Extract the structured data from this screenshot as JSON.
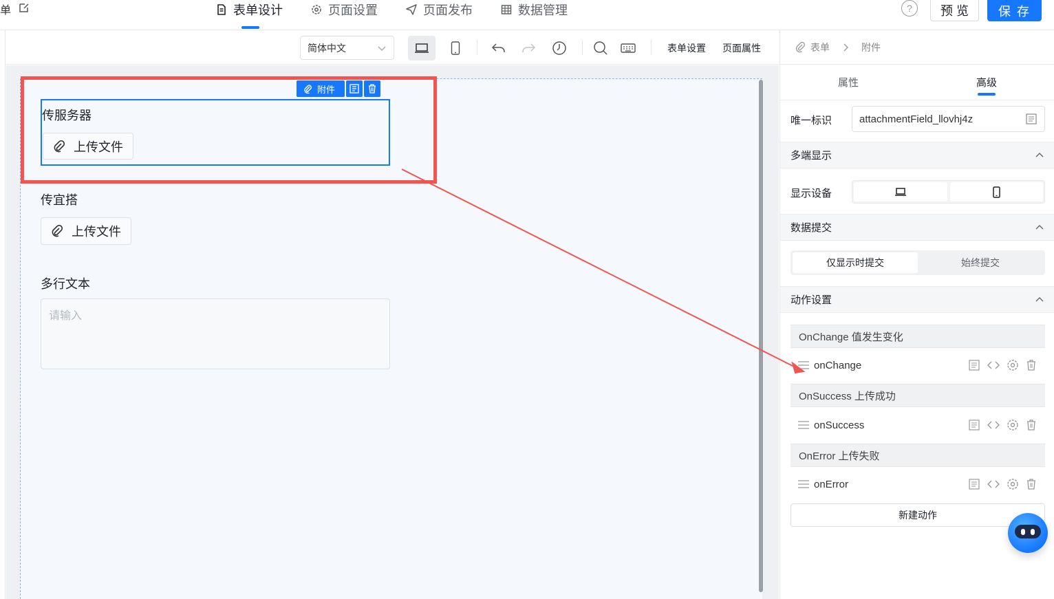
{
  "header": {
    "left_partial_text": "单",
    "tabs": [
      {
        "label": "表单设计",
        "icon": "doc-icon",
        "active": true
      },
      {
        "label": "页面设置",
        "icon": "gear-icon",
        "active": false
      },
      {
        "label": "页面发布",
        "icon": "send-icon",
        "active": false
      },
      {
        "label": "数据管理",
        "icon": "grid-icon",
        "active": false
      }
    ],
    "help_glyph": "?",
    "preview_label": "预 览",
    "save_label": "保 存",
    "accent_color": "#1677ff"
  },
  "toolbar": {
    "language": "简体中文",
    "form_settings_label": "表单设置",
    "page_props_label": "页面属性"
  },
  "canvas": {
    "fields": [
      {
        "label": "传服务器",
        "button": "上传文件",
        "selected": true
      },
      {
        "label": "传宜搭",
        "button": "上传文件",
        "selected": false
      },
      {
        "label": "多行文本",
        "placeholder": "请输入"
      }
    ],
    "selected_tag": "附件"
  },
  "right_panel": {
    "breadcrumb": [
      "表单",
      "附件"
    ],
    "tabs": [
      {
        "label": "属性",
        "active": false
      },
      {
        "label": "高级",
        "active": true
      }
    ],
    "unique_id_label": "唯一标识",
    "unique_id_value": "attachmentField_llovhj4z",
    "multi_display_section": "多端显示",
    "display_device_label": "显示设备",
    "data_submit_section": "数据提交",
    "submit_options": [
      "仅显示时提交",
      "始终提交"
    ],
    "action_settings_section": "动作设置",
    "action_groups": [
      {
        "title": "OnChange 值发生变化",
        "action": "onChange"
      },
      {
        "title": "OnSuccess 上传成功",
        "action": "onSuccess"
      },
      {
        "title": "OnError 上传失败",
        "action": "onError"
      }
    ],
    "new_action_label": "新建动作"
  },
  "annotation": {
    "color": "#f0554f"
  }
}
